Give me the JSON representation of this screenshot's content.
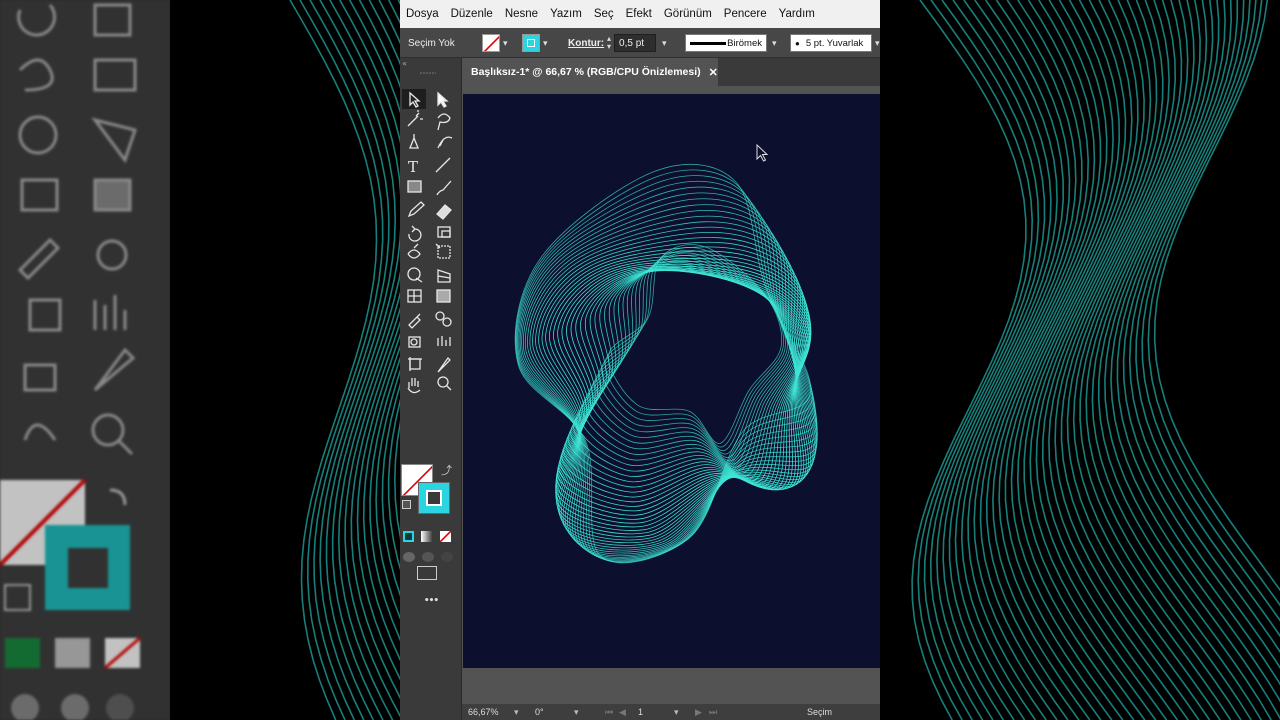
{
  "menubar": {
    "items": [
      "Dosya",
      "Düzenle",
      "Nesne",
      "Yazım",
      "Seç",
      "Efekt",
      "Görünüm",
      "Pencere",
      "Yardım"
    ]
  },
  "controlbar": {
    "selection_label": "Seçim Yok",
    "stroke_label": "Kontur:",
    "stroke_weight": "0,5 pt",
    "profile_label": "Birömek",
    "brush_label": "5 pt. Yuvarlak"
  },
  "document_tab": {
    "title": "Başlıksız-1* @ 66,67 % (RGB/CPU Önizlemesi)",
    "close": "✕"
  },
  "statusbar": {
    "zoom": "66,67%",
    "rotation": "0°",
    "artboard_number": "1",
    "tool_name": "Seçim"
  },
  "colors": {
    "accent": "#3ee6d6",
    "fill_swatch": "#2ad4e0",
    "artboard": "#0c0f2e"
  },
  "toolbar": {
    "more_label": "•••"
  }
}
